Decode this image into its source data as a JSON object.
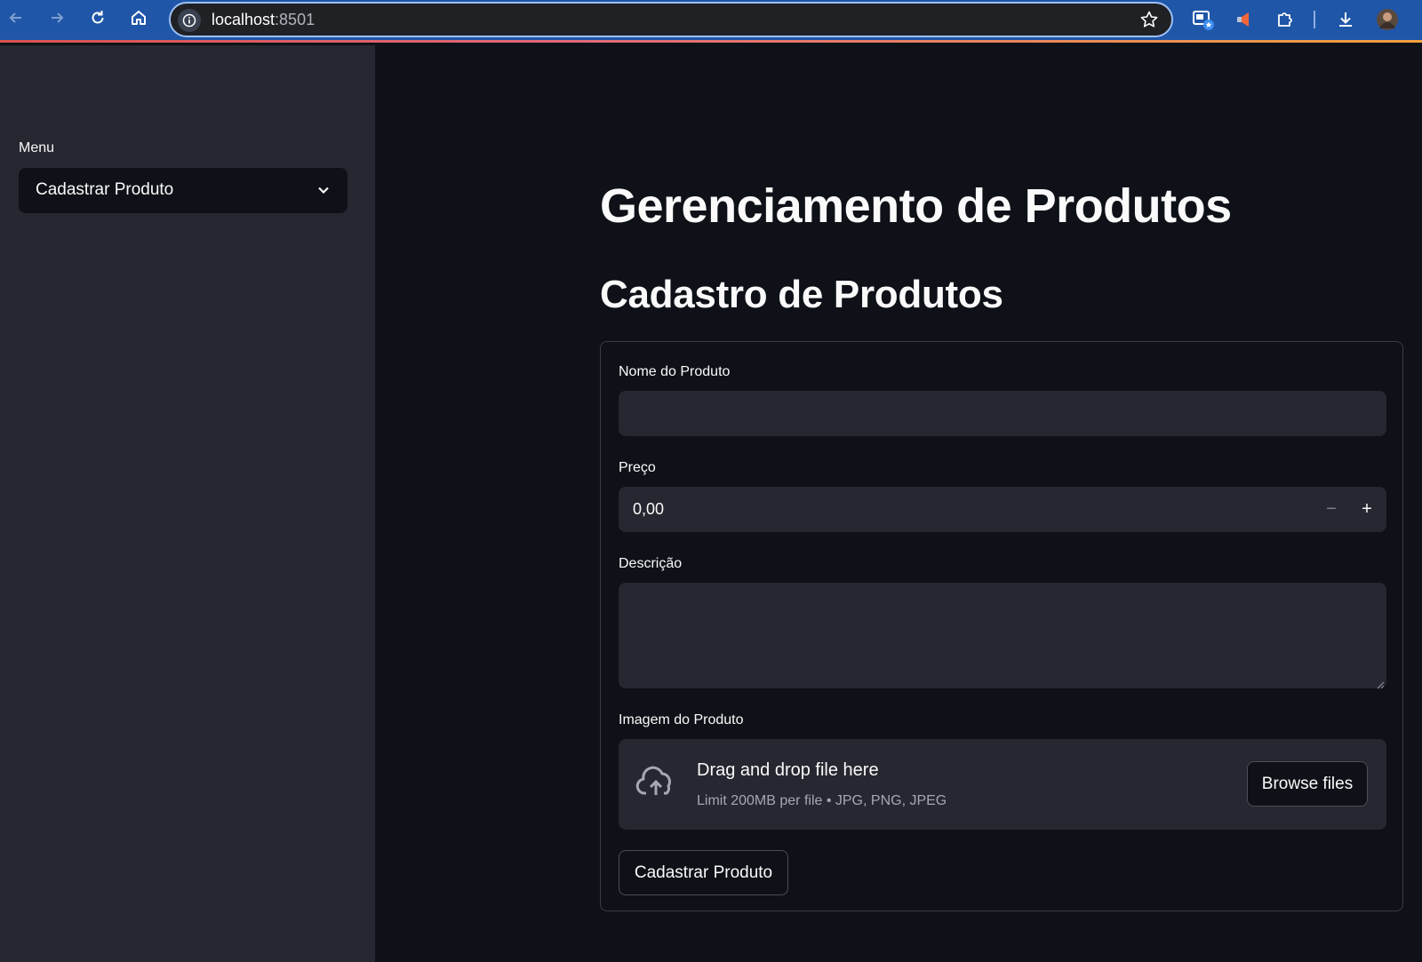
{
  "browser": {
    "url_host": "localhost",
    "url_port": ":8501",
    "icons": [
      "back-icon",
      "forward-icon",
      "reload-icon",
      "home-icon",
      "site-info-icon",
      "bookmark-star-icon",
      "tab-search-icon",
      "extension-icon",
      "puzzle-icon",
      "download-icon",
      "profile-avatar"
    ]
  },
  "sidebar": {
    "menu_label": "Menu",
    "menu_selected": "Cadastrar Produto"
  },
  "main": {
    "page_title": "Gerenciamento de Produtos",
    "section_title": "Cadastro de Produtos",
    "form": {
      "name_label": "Nome do Produto",
      "name_value": "",
      "price_label": "Preço",
      "price_value": "0,00",
      "price_decrement": "−",
      "price_increment": "+",
      "description_label": "Descrição",
      "description_value": "",
      "image_label": "Imagem do Produto",
      "dropzone_title": "Drag and drop file here",
      "dropzone_limits": "Limit 200MB per file • JPG, PNG, JPEG",
      "browse_button": "Browse files",
      "submit_button": "Cadastrar Produto"
    }
  },
  "colors": {
    "background": "#0e1117",
    "sidebar": "#262730",
    "input": "#262730",
    "text": "#fafafa",
    "browser_bar": "#1f56a8"
  }
}
